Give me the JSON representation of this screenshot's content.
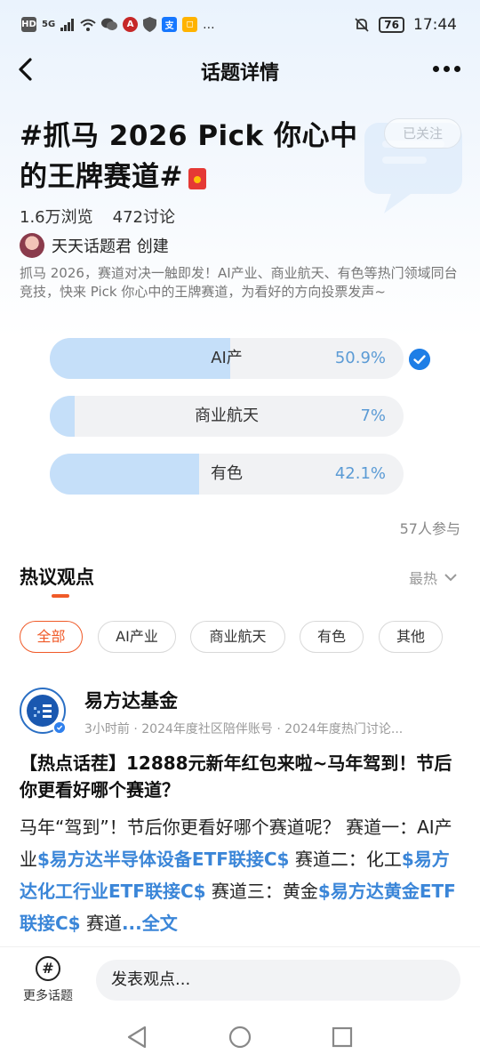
{
  "status_bar": {
    "time": "17:44",
    "battery": "76",
    "left_icons": [
      "HD",
      "5G",
      "signal-icon",
      "wifi-icon",
      "wechat-icon",
      "app-icon",
      "shield-icon",
      "alipay-icon",
      "app-icon-2",
      "..."
    ]
  },
  "nav": {
    "title": "话题详情"
  },
  "topic": {
    "title": "#抓马 2026  Pick 你心中的王牌赛道#",
    "follow_label": "已关注",
    "views": "1.6万浏览",
    "discussions": "472讨论",
    "creator": "天天话题君 创建",
    "description": "抓马 2026，赛道对决一触即发！AI产业、商业航天、有色等热门领域同台竞技，快来 Pick 你心中的王牌赛道，为看好的方向投票发声~"
  },
  "poll": {
    "options": [
      {
        "label": "AI产",
        "percent_text": "50.9%",
        "fraction": 0.509,
        "selected": true
      },
      {
        "label": "商业航天",
        "percent_text": "7%",
        "fraction": 0.07,
        "selected": false
      },
      {
        "label": "有色",
        "percent_text": "42.1%",
        "fraction": 0.421,
        "selected": false
      }
    ],
    "participants": "57人参与"
  },
  "hot": {
    "title": "热议观点",
    "sort_label": "最热",
    "filters": [
      "全部",
      "AI产业",
      "商业航天",
      "有色",
      "其他"
    ]
  },
  "post": {
    "author": "易方达基金",
    "meta": "3小时前 · 2024年度社区陪伴账号 · 2024年度热门讨论...",
    "headline": "【热点话茬】12888元新年红包来啦~马年驾到！节后你更看好哪个赛道？",
    "body": [
      {
        "text": "马年“驾到”！节后你更看好哪个赛道呢？ 赛道一：AI产业"
      },
      {
        "text": "$易方达半导体设备ETF联接C$",
        "link": true
      },
      {
        "text": " 赛道二：化工"
      },
      {
        "text": "$易方达化工行业ETF联接C$",
        "link": true
      },
      {
        "text": " 赛道三：黄金"
      },
      {
        "text": "$易方达黄金ETF联接C$",
        "link": true
      },
      {
        "text": " 赛道"
      },
      {
        "text": "...全文",
        "link": true
      }
    ]
  },
  "bottom": {
    "more_topics": "更多话题",
    "comment_placeholder": "发表观点..."
  },
  "colors": {
    "accent_orange": "#f05a28",
    "poll_fill": "#c5dff9",
    "link_blue": "#3b86d8",
    "check_blue": "#1e7ee6"
  }
}
